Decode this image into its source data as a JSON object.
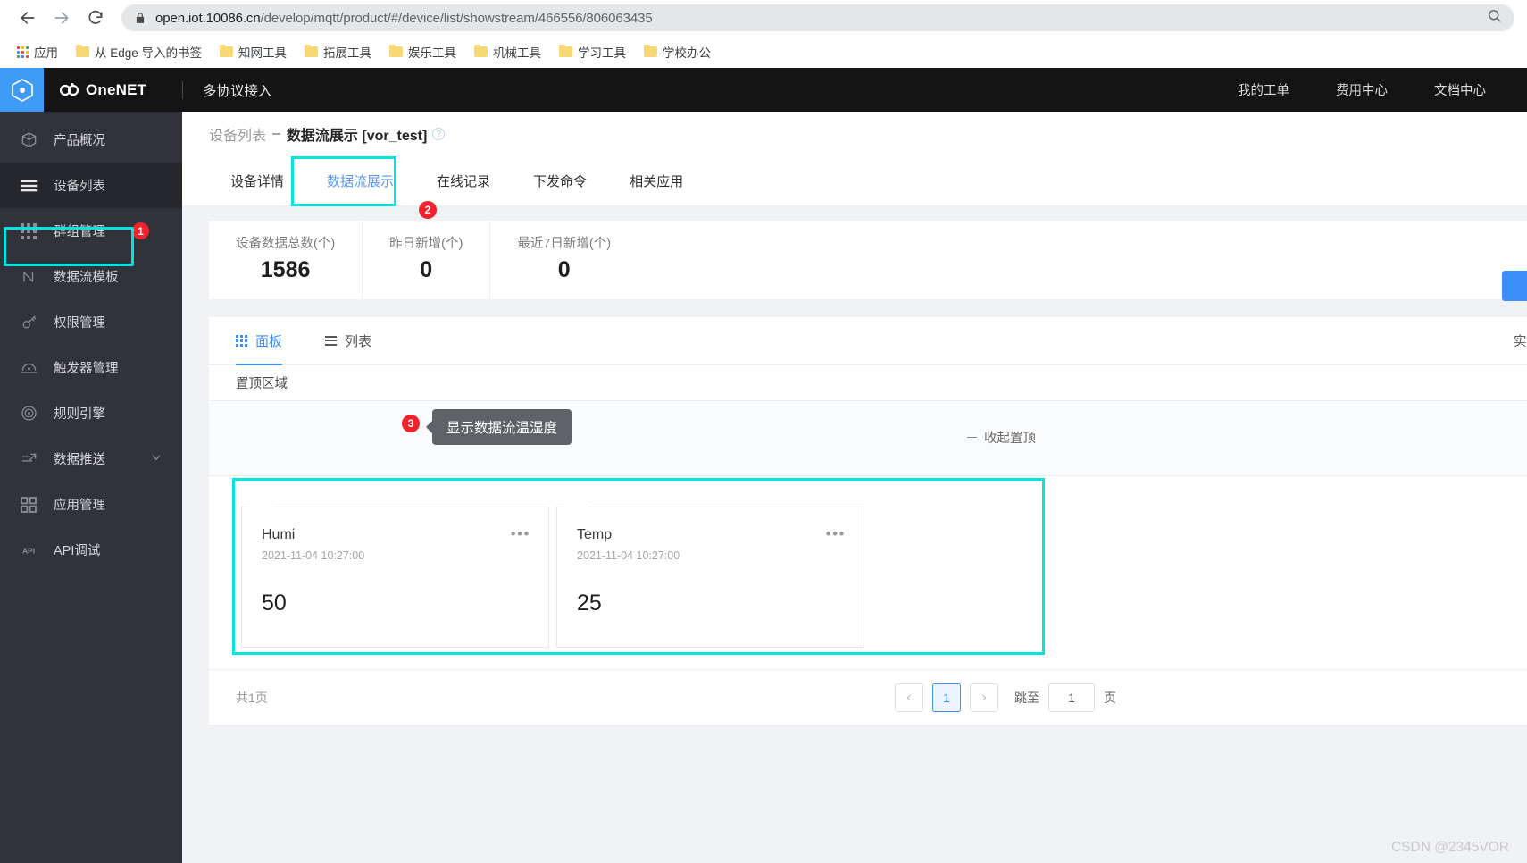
{
  "browser": {
    "back_icon": "back-arrow-icon",
    "forward_icon": "forward-arrow-icon",
    "reload_icon": "reload-icon",
    "lock_icon": "lock-icon",
    "url_host": "open.iot.10086.cn",
    "url_path": "/develop/mqtt/product/#/device/list/showstream/466556/806063435",
    "zoom_icon": "search-zoom-icon",
    "bookmarks": [
      {
        "label": "应用",
        "icon": "apps-grid-icon"
      },
      {
        "label": "从 Edge 导入的书签",
        "icon": "folder-icon"
      },
      {
        "label": "知网工具",
        "icon": "folder-icon"
      },
      {
        "label": "拓展工具",
        "icon": "folder-icon"
      },
      {
        "label": "娱乐工具",
        "icon": "folder-icon"
      },
      {
        "label": "机械工具",
        "icon": "folder-icon"
      },
      {
        "label": "学习工具",
        "icon": "folder-icon"
      },
      {
        "label": "学校办公",
        "icon": "folder-icon"
      }
    ]
  },
  "brand": {
    "logo_icon": "onenet-hexagon-logo",
    "name": "OneNET",
    "subtitle": "多协议接入"
  },
  "topnav": {
    "links": [
      {
        "label": "我的工单"
      },
      {
        "label": "费用中心"
      },
      {
        "label": "文档中心"
      }
    ]
  },
  "sidebar": {
    "items": [
      {
        "label": "产品概况",
        "icon": "cube-icon",
        "active": false,
        "badge": ""
      },
      {
        "label": "设备列表",
        "icon": "list-lines-icon",
        "active": true,
        "badge": ""
      },
      {
        "label": "群组管理",
        "icon": "grid-dots-icon",
        "active": false,
        "badge": "1"
      },
      {
        "label": "数据流模板",
        "icon": "n-curve-icon",
        "active": false,
        "badge": ""
      },
      {
        "label": "权限管理",
        "icon": "key-icon",
        "active": false,
        "badge": ""
      },
      {
        "label": "触发器管理",
        "icon": "trigger-icon",
        "active": false,
        "badge": ""
      },
      {
        "label": "规则引擎",
        "icon": "spiral-icon",
        "active": false,
        "badge": ""
      },
      {
        "label": "数据推送",
        "icon": "push-arrow-icon",
        "active": false,
        "badge": "",
        "caret": "chevron-down-icon"
      },
      {
        "label": "应用管理",
        "icon": "squares-icon",
        "active": false,
        "badge": ""
      },
      {
        "label": "API调试",
        "icon": "api-icon",
        "active": false,
        "badge": ""
      }
    ]
  },
  "breadcrumb": {
    "parent": "设备列表",
    "separator": "–",
    "current": "数据流展示 [vor_test]",
    "help_icon": "question-mark-icon"
  },
  "tabs": {
    "items": [
      {
        "label": "设备详情",
        "active": false
      },
      {
        "label": "数据流展示",
        "active": true
      },
      {
        "label": "在线记录",
        "active": false
      },
      {
        "label": "下发命令",
        "active": false
      },
      {
        "label": "相关应用",
        "active": false
      }
    ],
    "step_badge": "2"
  },
  "stats": [
    {
      "label": "设备数据总数(个)",
      "value": "1586"
    },
    {
      "label": "昨日新增(个)",
      "value": "0"
    },
    {
      "label": "最近7日新增(个)",
      "value": "0"
    }
  ],
  "panel": {
    "view_tabs": [
      {
        "label": "面板",
        "icon": "grid-dots-icon",
        "active": true
      },
      {
        "label": "列表",
        "icon": "list-icon",
        "active": false
      }
    ],
    "realtime_label": "实时",
    "pin_section_label": "置顶区域",
    "collapse_pin_label": "收起置顶",
    "tooltip_text": "显示数据流温湿度",
    "tooltip_badge": "3",
    "cards": [
      {
        "name": "Humi",
        "time": "2021-11-04 10:27:00",
        "value": "50",
        "more_icon": "ellipsis-icon"
      },
      {
        "name": "Temp",
        "time": "2021-11-04 10:27:00",
        "value": "25",
        "more_icon": "ellipsis-icon"
      }
    ]
  },
  "pagination": {
    "total_label": "共1页",
    "prev_icon": "chevron-left-icon",
    "next_icon": "chevron-right-icon",
    "current_page": "1",
    "jump_label": "跳至",
    "jump_value": "1",
    "jump_unit": "页"
  },
  "watermark": "CSDN @2345VOR",
  "colors": {
    "highlight": "#00e5e0",
    "badge_red": "#f5222d",
    "accent_blue": "#3e8ef7",
    "sidebar_bg": "#31323a",
    "topbar_bg": "#141414"
  }
}
